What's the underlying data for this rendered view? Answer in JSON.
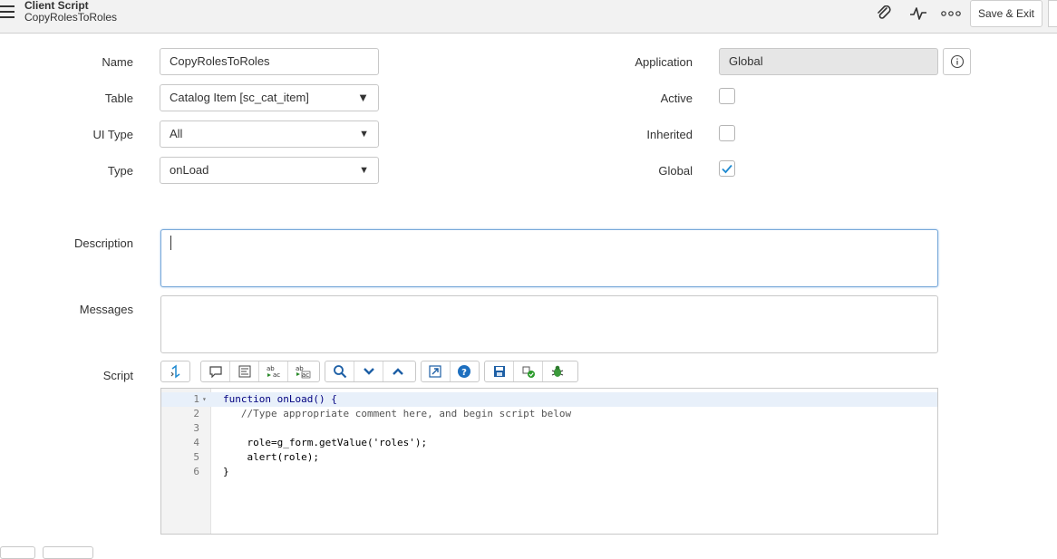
{
  "header": {
    "title": "Client Script",
    "subtitle": "CopyRolesToRoles",
    "save_exit_label": "Save & Exit"
  },
  "form": {
    "name_label": "Name",
    "name_value": "CopyRolesToRoles",
    "table_label": "Table",
    "table_value": "Catalog Item [sc_cat_item]",
    "ui_type_label": "UI Type",
    "ui_type_value": "All",
    "type_label": "Type",
    "type_value": "onLoad",
    "application_label": "Application",
    "application_value": "Global",
    "active_label": "Active",
    "active_checked": false,
    "inherited_label": "Inherited",
    "inherited_checked": false,
    "global_label": "Global",
    "global_checked": true,
    "description_label": "Description",
    "description_value": "",
    "messages_label": "Messages",
    "messages_value": "",
    "script_label": "Script"
  },
  "script": {
    "line_numbers": [
      "1",
      "2",
      "3",
      "4",
      "5",
      "6"
    ],
    "lines": [
      "function onLoad() {",
      "   //Type appropriate comment here, and begin script below",
      "",
      "    role=g_form.getValue('roles');",
      "    alert(role);",
      "}"
    ]
  },
  "colors": {
    "accent": "#1f8ad1",
    "header_bg": "#f2f2f2"
  }
}
